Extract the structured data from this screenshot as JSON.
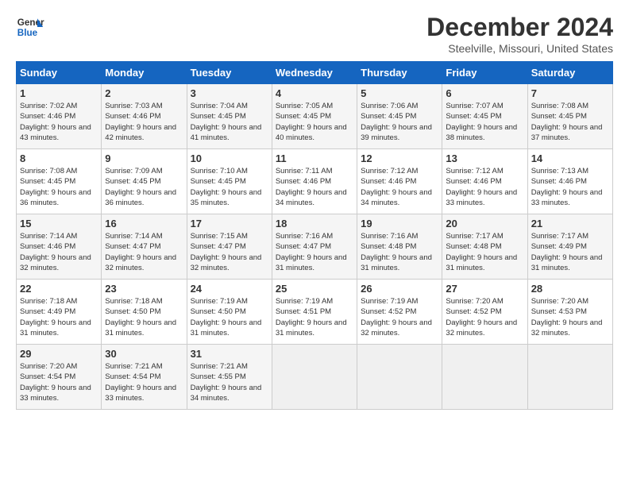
{
  "logo": {
    "line1": "General",
    "line2": "Blue"
  },
  "title": "December 2024",
  "location": "Steelville, Missouri, United States",
  "days_of_week": [
    "Sunday",
    "Monday",
    "Tuesday",
    "Wednesday",
    "Thursday",
    "Friday",
    "Saturday"
  ],
  "weeks": [
    [
      {
        "day": "1",
        "sunrise": "7:02 AM",
        "sunset": "4:46 PM",
        "daylight": "9 hours and 43 minutes."
      },
      {
        "day": "2",
        "sunrise": "7:03 AM",
        "sunset": "4:46 PM",
        "daylight": "9 hours and 42 minutes."
      },
      {
        "day": "3",
        "sunrise": "7:04 AM",
        "sunset": "4:45 PM",
        "daylight": "9 hours and 41 minutes."
      },
      {
        "day": "4",
        "sunrise": "7:05 AM",
        "sunset": "4:45 PM",
        "daylight": "9 hours and 40 minutes."
      },
      {
        "day": "5",
        "sunrise": "7:06 AM",
        "sunset": "4:45 PM",
        "daylight": "9 hours and 39 minutes."
      },
      {
        "day": "6",
        "sunrise": "7:07 AM",
        "sunset": "4:45 PM",
        "daylight": "9 hours and 38 minutes."
      },
      {
        "day": "7",
        "sunrise": "7:08 AM",
        "sunset": "4:45 PM",
        "daylight": "9 hours and 37 minutes."
      }
    ],
    [
      {
        "day": "8",
        "sunrise": "7:08 AM",
        "sunset": "4:45 PM",
        "daylight": "9 hours and 36 minutes."
      },
      {
        "day": "9",
        "sunrise": "7:09 AM",
        "sunset": "4:45 PM",
        "daylight": "9 hours and 36 minutes."
      },
      {
        "day": "10",
        "sunrise": "7:10 AM",
        "sunset": "4:45 PM",
        "daylight": "9 hours and 35 minutes."
      },
      {
        "day": "11",
        "sunrise": "7:11 AM",
        "sunset": "4:46 PM",
        "daylight": "9 hours and 34 minutes."
      },
      {
        "day": "12",
        "sunrise": "7:12 AM",
        "sunset": "4:46 PM",
        "daylight": "9 hours and 34 minutes."
      },
      {
        "day": "13",
        "sunrise": "7:12 AM",
        "sunset": "4:46 PM",
        "daylight": "9 hours and 33 minutes."
      },
      {
        "day": "14",
        "sunrise": "7:13 AM",
        "sunset": "4:46 PM",
        "daylight": "9 hours and 33 minutes."
      }
    ],
    [
      {
        "day": "15",
        "sunrise": "7:14 AM",
        "sunset": "4:46 PM",
        "daylight": "9 hours and 32 minutes."
      },
      {
        "day": "16",
        "sunrise": "7:14 AM",
        "sunset": "4:47 PM",
        "daylight": "9 hours and 32 minutes."
      },
      {
        "day": "17",
        "sunrise": "7:15 AM",
        "sunset": "4:47 PM",
        "daylight": "9 hours and 32 minutes."
      },
      {
        "day": "18",
        "sunrise": "7:16 AM",
        "sunset": "4:47 PM",
        "daylight": "9 hours and 31 minutes."
      },
      {
        "day": "19",
        "sunrise": "7:16 AM",
        "sunset": "4:48 PM",
        "daylight": "9 hours and 31 minutes."
      },
      {
        "day": "20",
        "sunrise": "7:17 AM",
        "sunset": "4:48 PM",
        "daylight": "9 hours and 31 minutes."
      },
      {
        "day": "21",
        "sunrise": "7:17 AM",
        "sunset": "4:49 PM",
        "daylight": "9 hours and 31 minutes."
      }
    ],
    [
      {
        "day": "22",
        "sunrise": "7:18 AM",
        "sunset": "4:49 PM",
        "daylight": "9 hours and 31 minutes."
      },
      {
        "day": "23",
        "sunrise": "7:18 AM",
        "sunset": "4:50 PM",
        "daylight": "9 hours and 31 minutes."
      },
      {
        "day": "24",
        "sunrise": "7:19 AM",
        "sunset": "4:50 PM",
        "daylight": "9 hours and 31 minutes."
      },
      {
        "day": "25",
        "sunrise": "7:19 AM",
        "sunset": "4:51 PM",
        "daylight": "9 hours and 31 minutes."
      },
      {
        "day": "26",
        "sunrise": "7:19 AM",
        "sunset": "4:52 PM",
        "daylight": "9 hours and 32 minutes."
      },
      {
        "day": "27",
        "sunrise": "7:20 AM",
        "sunset": "4:52 PM",
        "daylight": "9 hours and 32 minutes."
      },
      {
        "day": "28",
        "sunrise": "7:20 AM",
        "sunset": "4:53 PM",
        "daylight": "9 hours and 32 minutes."
      }
    ],
    [
      {
        "day": "29",
        "sunrise": "7:20 AM",
        "sunset": "4:54 PM",
        "daylight": "9 hours and 33 minutes."
      },
      {
        "day": "30",
        "sunrise": "7:21 AM",
        "sunset": "4:54 PM",
        "daylight": "9 hours and 33 minutes."
      },
      {
        "day": "31",
        "sunrise": "7:21 AM",
        "sunset": "4:55 PM",
        "daylight": "9 hours and 34 minutes."
      },
      null,
      null,
      null,
      null
    ]
  ]
}
